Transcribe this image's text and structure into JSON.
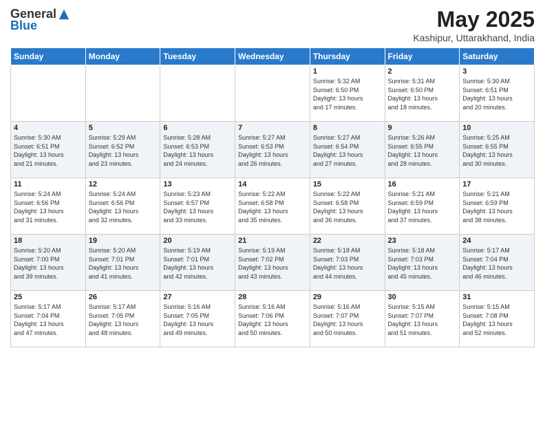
{
  "header": {
    "logo_general": "General",
    "logo_blue": "Blue",
    "month_title": "May 2025",
    "location": "Kashipur, Uttarakhand, India"
  },
  "days_of_week": [
    "Sunday",
    "Monday",
    "Tuesday",
    "Wednesday",
    "Thursday",
    "Friday",
    "Saturday"
  ],
  "weeks": [
    {
      "days": [
        {
          "number": "",
          "info": ""
        },
        {
          "number": "",
          "info": ""
        },
        {
          "number": "",
          "info": ""
        },
        {
          "number": "",
          "info": ""
        },
        {
          "number": "1",
          "info": "Sunrise: 5:32 AM\nSunset: 6:50 PM\nDaylight: 13 hours\nand 17 minutes."
        },
        {
          "number": "2",
          "info": "Sunrise: 5:31 AM\nSunset: 6:50 PM\nDaylight: 13 hours\nand 18 minutes."
        },
        {
          "number": "3",
          "info": "Sunrise: 5:30 AM\nSunset: 6:51 PM\nDaylight: 13 hours\nand 20 minutes."
        }
      ]
    },
    {
      "days": [
        {
          "number": "4",
          "info": "Sunrise: 5:30 AM\nSunset: 6:51 PM\nDaylight: 13 hours\nand 21 minutes."
        },
        {
          "number": "5",
          "info": "Sunrise: 5:29 AM\nSunset: 6:52 PM\nDaylight: 13 hours\nand 23 minutes."
        },
        {
          "number": "6",
          "info": "Sunrise: 5:28 AM\nSunset: 6:53 PM\nDaylight: 13 hours\nand 24 minutes."
        },
        {
          "number": "7",
          "info": "Sunrise: 5:27 AM\nSunset: 6:53 PM\nDaylight: 13 hours\nand 26 minutes."
        },
        {
          "number": "8",
          "info": "Sunrise: 5:27 AM\nSunset: 6:54 PM\nDaylight: 13 hours\nand 27 minutes."
        },
        {
          "number": "9",
          "info": "Sunrise: 5:26 AM\nSunset: 6:55 PM\nDaylight: 13 hours\nand 28 minutes."
        },
        {
          "number": "10",
          "info": "Sunrise: 5:25 AM\nSunset: 6:55 PM\nDaylight: 13 hours\nand 30 minutes."
        }
      ]
    },
    {
      "days": [
        {
          "number": "11",
          "info": "Sunrise: 5:24 AM\nSunset: 6:56 PM\nDaylight: 13 hours\nand 31 minutes."
        },
        {
          "number": "12",
          "info": "Sunrise: 5:24 AM\nSunset: 6:56 PM\nDaylight: 13 hours\nand 32 minutes."
        },
        {
          "number": "13",
          "info": "Sunrise: 5:23 AM\nSunset: 6:57 PM\nDaylight: 13 hours\nand 33 minutes."
        },
        {
          "number": "14",
          "info": "Sunrise: 5:22 AM\nSunset: 6:58 PM\nDaylight: 13 hours\nand 35 minutes."
        },
        {
          "number": "15",
          "info": "Sunrise: 5:22 AM\nSunset: 6:58 PM\nDaylight: 13 hours\nand 36 minutes."
        },
        {
          "number": "16",
          "info": "Sunrise: 5:21 AM\nSunset: 6:59 PM\nDaylight: 13 hours\nand 37 minutes."
        },
        {
          "number": "17",
          "info": "Sunrise: 5:21 AM\nSunset: 6:59 PM\nDaylight: 13 hours\nand 38 minutes."
        }
      ]
    },
    {
      "days": [
        {
          "number": "18",
          "info": "Sunrise: 5:20 AM\nSunset: 7:00 PM\nDaylight: 13 hours\nand 39 minutes."
        },
        {
          "number": "19",
          "info": "Sunrise: 5:20 AM\nSunset: 7:01 PM\nDaylight: 13 hours\nand 41 minutes."
        },
        {
          "number": "20",
          "info": "Sunrise: 5:19 AM\nSunset: 7:01 PM\nDaylight: 13 hours\nand 42 minutes."
        },
        {
          "number": "21",
          "info": "Sunrise: 5:19 AM\nSunset: 7:02 PM\nDaylight: 13 hours\nand 43 minutes."
        },
        {
          "number": "22",
          "info": "Sunrise: 5:18 AM\nSunset: 7:03 PM\nDaylight: 13 hours\nand 44 minutes."
        },
        {
          "number": "23",
          "info": "Sunrise: 5:18 AM\nSunset: 7:03 PM\nDaylight: 13 hours\nand 45 minutes."
        },
        {
          "number": "24",
          "info": "Sunrise: 5:17 AM\nSunset: 7:04 PM\nDaylight: 13 hours\nand 46 minutes."
        }
      ]
    },
    {
      "days": [
        {
          "number": "25",
          "info": "Sunrise: 5:17 AM\nSunset: 7:04 PM\nDaylight: 13 hours\nand 47 minutes."
        },
        {
          "number": "26",
          "info": "Sunrise: 5:17 AM\nSunset: 7:05 PM\nDaylight: 13 hours\nand 48 minutes."
        },
        {
          "number": "27",
          "info": "Sunrise: 5:16 AM\nSunset: 7:05 PM\nDaylight: 13 hours\nand 49 minutes."
        },
        {
          "number": "28",
          "info": "Sunrise: 5:16 AM\nSunset: 7:06 PM\nDaylight: 13 hours\nand 50 minutes."
        },
        {
          "number": "29",
          "info": "Sunrise: 5:16 AM\nSunset: 7:07 PM\nDaylight: 13 hours\nand 50 minutes."
        },
        {
          "number": "30",
          "info": "Sunrise: 5:15 AM\nSunset: 7:07 PM\nDaylight: 13 hours\nand 51 minutes."
        },
        {
          "number": "31",
          "info": "Sunrise: 5:15 AM\nSunset: 7:08 PM\nDaylight: 13 hours\nand 52 minutes."
        }
      ]
    }
  ]
}
